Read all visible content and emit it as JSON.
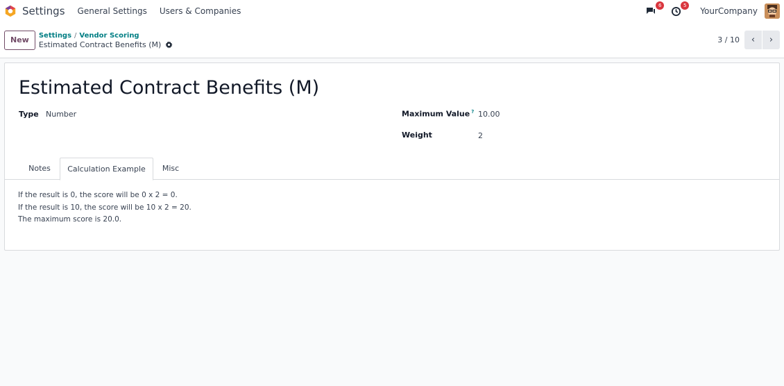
{
  "navbar": {
    "app_name": "Settings",
    "menus": [
      "General Settings",
      "Users & Companies"
    ],
    "chat_count": "6",
    "activity_count": "5",
    "company": "YourCompany"
  },
  "control": {
    "new_label": "New",
    "breadcrumb": [
      "Settings",
      "Vendor Scoring"
    ],
    "record_title": "Estimated Contract Benefits (M)",
    "pager": "3 / 10"
  },
  "form": {
    "title": "Estimated Contract Benefits (M)",
    "type_label": "Type",
    "type_value": "Number",
    "max_label": "Maximum Value",
    "max_help": "?",
    "max_value": "10.00",
    "weight_label": "Weight",
    "weight_value": "2"
  },
  "tabs": [
    "Notes",
    "Calculation Example",
    "Misc"
  ],
  "active_tab": "Calculation Example",
  "calculation": [
    "If the result is 0, the score will be 0 x 2 = 0.",
    "If the result is 10, the score will be 10 x 2 = 20.",
    "The maximum score is 20.0."
  ],
  "colors": {
    "brand": "#714b67",
    "link": "#017e84",
    "badge": "#d9363e"
  },
  "icons": [
    "odoo-logo-icon",
    "chat-icon",
    "clock-icon",
    "gear-icon",
    "chevron-left-icon",
    "chevron-right-icon"
  ]
}
